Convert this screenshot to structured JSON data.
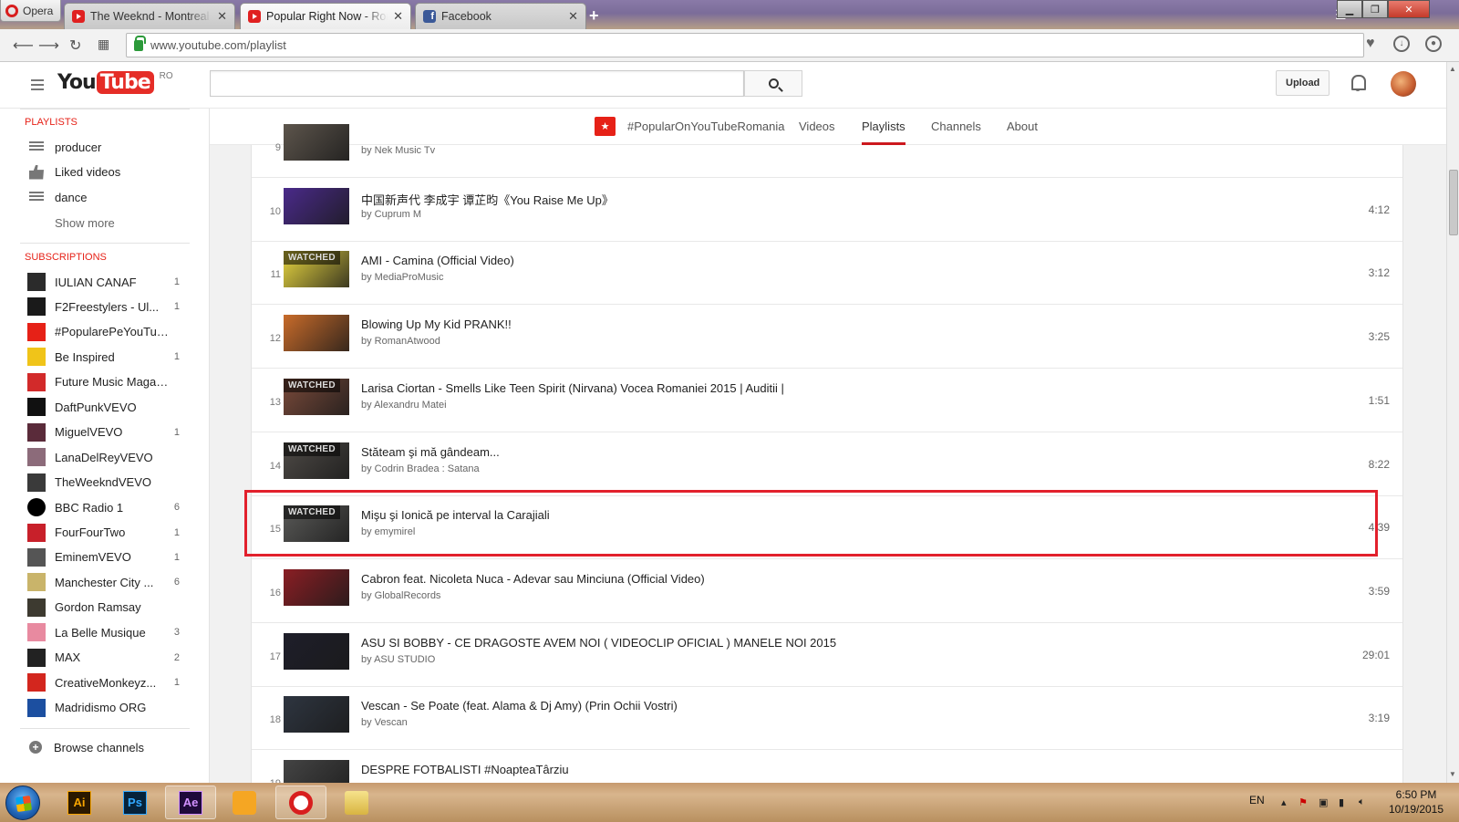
{
  "browser": {
    "menu_label": "Opera",
    "tabs": [
      {
        "title": "The Weeknd - Montreal - YouTube",
        "icon": "youtube-favicon-icon",
        "active": false
      },
      {
        "title": "Popular Right Now - Romania - YouTube",
        "icon": "youtube-favicon-icon",
        "active": true
      },
      {
        "title": "Facebook",
        "icon": "facebook-favicon-icon",
        "active": false
      }
    ],
    "new_tab": "+",
    "url": "www.youtube.com/playlist"
  },
  "masthead": {
    "logo_you": "You",
    "logo_tube": "Tube",
    "country_code": "RO",
    "search_placeholder": "",
    "upload_label": "Upload"
  },
  "sidebar": {
    "playlists_title": "PLAYLISTS",
    "playlists": [
      {
        "label": "producer",
        "icon": "list-icon"
      },
      {
        "label": "Liked videos",
        "icon": "thumbs-up-icon"
      },
      {
        "label": "dance",
        "icon": "list-icon"
      }
    ],
    "show_more": "Show more",
    "subscriptions_title": "SUBSCRIPTIONS",
    "subscriptions": [
      {
        "label": "IULIAN CANAF",
        "count": "1",
        "color": "#2b2b2b"
      },
      {
        "label": "F2Freestylers - Ul...",
        "count": "1",
        "color": "#1a1a1a"
      },
      {
        "label": "#PopularePeYouTube...",
        "count": "",
        "color": "#e62117"
      },
      {
        "label": "Be Inspired",
        "count": "1",
        "color": "#f0c419"
      },
      {
        "label": "Future Music Magazine",
        "count": "",
        "color": "#d22a2a"
      },
      {
        "label": "DaftPunkVEVO",
        "count": "",
        "color": "#111111"
      },
      {
        "label": "MiguelVEVO",
        "count": "1",
        "color": "#5a2b3a"
      },
      {
        "label": "LanaDelReyVEVO",
        "count": "",
        "color": "#8c6b7a"
      },
      {
        "label": "TheWeekndVEVO",
        "count": "",
        "color": "#3a3a3a"
      },
      {
        "label": "BBC Radio 1",
        "count": "6",
        "color": "#000000"
      },
      {
        "label": "FourFourTwo",
        "count": "1",
        "color": "#c8202a"
      },
      {
        "label": "EminemVEVO",
        "count": "1",
        "color": "#555555"
      },
      {
        "label": "Manchester City ...",
        "count": "6",
        "color": "#c9b46a"
      },
      {
        "label": "Gordon Ramsay",
        "count": "",
        "color": "#3d3a30"
      },
      {
        "label": "La Belle Musique",
        "count": "3",
        "color": "#e88aa0"
      },
      {
        "label": "MAX",
        "count": "2",
        "color": "#222222"
      },
      {
        "label": "CreativeMonkeyz...",
        "count": "1",
        "color": "#d3261e"
      },
      {
        "label": "Madridismo ORG",
        "count": "",
        "color": "#1c4fa0"
      }
    ],
    "browse_channels": "Browse channels"
  },
  "channel_nav": {
    "channel": "#PopularOnYouTubeRomania",
    "tabs": [
      "Videos",
      "Playlists",
      "Channels",
      "About"
    ],
    "active_tab": "Playlists"
  },
  "playlist": {
    "watched_label": "WATCHED",
    "rows": [
      {
        "index": "9",
        "title": "",
        "by": "by Nek Music Tv",
        "duration": "",
        "watched": false,
        "thumb": "#5d554c"
      },
      {
        "index": "10",
        "title": "中国新声代 李成宇 谭芷昀《You Raise Me Up》",
        "by": "by Cuprum M",
        "duration": "4:12",
        "watched": false,
        "thumb": "#4a2a8a"
      },
      {
        "index": "11",
        "title": "AMI - Camina (Official Video)",
        "by": "by MediaProMusic",
        "duration": "3:12",
        "watched": true,
        "thumb": "#e8d640"
      },
      {
        "index": "12",
        "title": "Blowing Up My Kid PRANK!!",
        "by": "by RomanAtwood",
        "duration": "3:25",
        "watched": false,
        "thumb": "#c86b2a"
      },
      {
        "index": "13",
        "title": "Larisa Ciortan - Smells Like Teen Spirit (Nirvana) Vocea Romaniei 2015 | Auditii |",
        "by": "by Alexandru Matei",
        "duration": "1:51",
        "watched": true,
        "thumb": "#7a4a3a"
      },
      {
        "index": "14",
        "title": "Stăteam şi mă gândeam...",
        "by": "by Codrin Bradea : Satana",
        "duration": "8:22",
        "watched": true,
        "thumb": "#4e4a46"
      },
      {
        "index": "15",
        "title": "Mişu şi Ionică pe interval la Carajiali",
        "by": "by emymirel",
        "duration": "4:39",
        "watched": true,
        "thumb": "#5a5a58"
      },
      {
        "index": "16",
        "title": "Cabron feat. Nicoleta Nuca - Adevar sau Minciuna (Official Video)",
        "by": "by GlobalRecords",
        "duration": "3:59",
        "watched": false,
        "thumb": "#8a1e24"
      },
      {
        "index": "17",
        "title": "ASU SI BOBBY - CE DRAGOSTE AVEM NOI ( VIDEOCLIP OFICIAL ) MANELE NOI 2015",
        "by": "by ASU STUDIO",
        "duration": "29:01",
        "watched": false,
        "thumb": "#1e1e2a"
      },
      {
        "index": "18",
        "title": "Vescan - Se Poate (feat. Alama & Dj Amy) (Prin Ochii Vostri)",
        "by": "by Vescan",
        "duration": "3:19",
        "watched": false,
        "thumb": "#2e3540"
      },
      {
        "index": "19",
        "title": "DESPRE FOTBALISTI #NoapteaTârziu",
        "by": "",
        "duration": "",
        "watched": false,
        "thumb": "#444444"
      }
    ]
  },
  "taskbar": {
    "apps": [
      {
        "label": "Ai",
        "name": "illustrator-icon"
      },
      {
        "label": "Ps",
        "name": "photoshop-icon"
      },
      {
        "label": "Ae",
        "name": "after-effects-icon"
      },
      {
        "label": "",
        "name": "video-player-icon"
      },
      {
        "label": "",
        "name": "opera-icon"
      },
      {
        "label": "",
        "name": "file-explorer-icon"
      }
    ],
    "language": "EN",
    "time": "6:50 PM",
    "date": "10/19/2015"
  },
  "colors": {
    "accent_red": "#e62117",
    "highlight_box": "#e2202c"
  }
}
